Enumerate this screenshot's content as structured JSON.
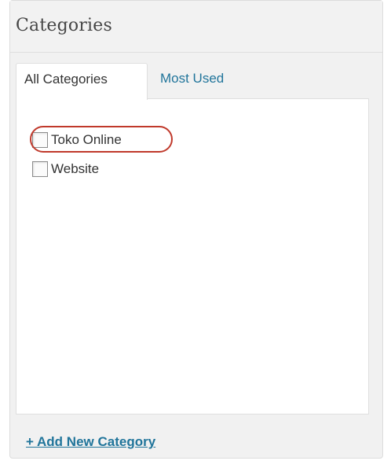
{
  "panel": {
    "title": "Categories"
  },
  "tabs": [
    {
      "label": "All Categories",
      "active": true
    },
    {
      "label": "Most Used",
      "active": false
    }
  ],
  "categories": [
    {
      "label": "Toko Online",
      "checked": false,
      "highlighted": true
    },
    {
      "label": "Website",
      "checked": false,
      "highlighted": false
    }
  ],
  "add_category": {
    "label": "+ Add New Category"
  },
  "colors": {
    "link": "#21759b",
    "highlight": "#c0392b",
    "panel_bg": "#f1f1f1"
  }
}
